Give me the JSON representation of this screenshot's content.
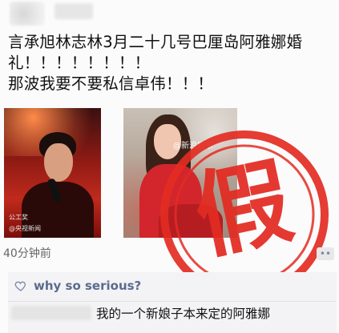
{
  "post": {
    "lines": [
      "言承旭林志林3月二十几号巴厘岛阿雅娜婚",
      "礼！！！！！！！！",
      "那波我要不要私信卓伟！！！"
    ],
    "timestamp": "40分钟前"
  },
  "images": {
    "left": {
      "watermark": "@央视新闻",
      "caption": "公工奖"
    },
    "right": {
      "watermark": "@新浪娱乐"
    }
  },
  "stamp": {
    "text": "假",
    "color": "#e32b22"
  },
  "actions": {
    "more_icon": "more-icon",
    "more_label": "••"
  },
  "interactions": {
    "like_icon": "heart-icon",
    "liker": "why so serious?",
    "comment_text": "我的一个新娘子本来定的阿雅娜"
  },
  "colors": {
    "link_blue": "#5a6b8e",
    "stamp_red": "#e32b22"
  }
}
